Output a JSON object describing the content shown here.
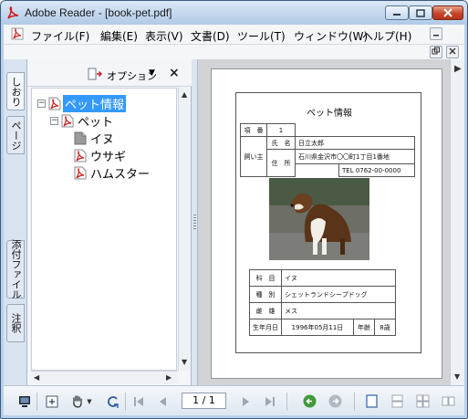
{
  "window": {
    "title": "Adobe Reader - [book-pet.pdf]"
  },
  "menubar": {
    "items": [
      {
        "label": "ファイル(F)"
      },
      {
        "label": "編集(E)"
      },
      {
        "label": "表示(V)"
      },
      {
        "label": "文書(D)"
      },
      {
        "label": "ツール(T)"
      },
      {
        "label": "ウィンドウ(W)"
      },
      {
        "label": "ヘルプ(H)"
      }
    ]
  },
  "nav_tabs": {
    "bookmarks": "しおり",
    "pages": "ページ",
    "attachments": "添付ファイル",
    "comments": "注釈"
  },
  "bookmarks_panel": {
    "options_label": "オプション",
    "close_symbol": "×",
    "tree": [
      {
        "label": "ペット情報",
        "selected": true,
        "expanded": true
      },
      {
        "label": "ペット",
        "selected": false,
        "expanded": true
      },
      {
        "label": "イヌ",
        "selected": false
      },
      {
        "label": "ウサギ",
        "selected": false
      },
      {
        "label": "ハムスター",
        "selected": false
      }
    ]
  },
  "document": {
    "title": "ペット情報",
    "rows": {
      "item_label": "項　番",
      "item_value": "1",
      "owner_label": "飼い主",
      "name_label": "氏　名",
      "name_value": "日立太郎",
      "address_label": "住　所",
      "address_value": "石川県金沢市〇〇町1丁目1番地",
      "tel_value": "TEL 0762-00-0000",
      "family_label": "科　目",
      "family_value": "イヌ",
      "breed_label": "種　別",
      "breed_value": "シェットランドシープドッグ",
      "sex_label": "雌　雄",
      "sex_value": "メス",
      "birth_label": "生年月日",
      "birth_value": "1996年05月11日",
      "age_label": "年齢",
      "age_value": "8歳"
    }
  },
  "bottom_toolbar": {
    "page_indicator": "1 / 1"
  },
  "colors": {
    "selection": "#3399ff",
    "pdf_icon_red": "#d01c1c",
    "title_bar": "#c3d7ee"
  }
}
